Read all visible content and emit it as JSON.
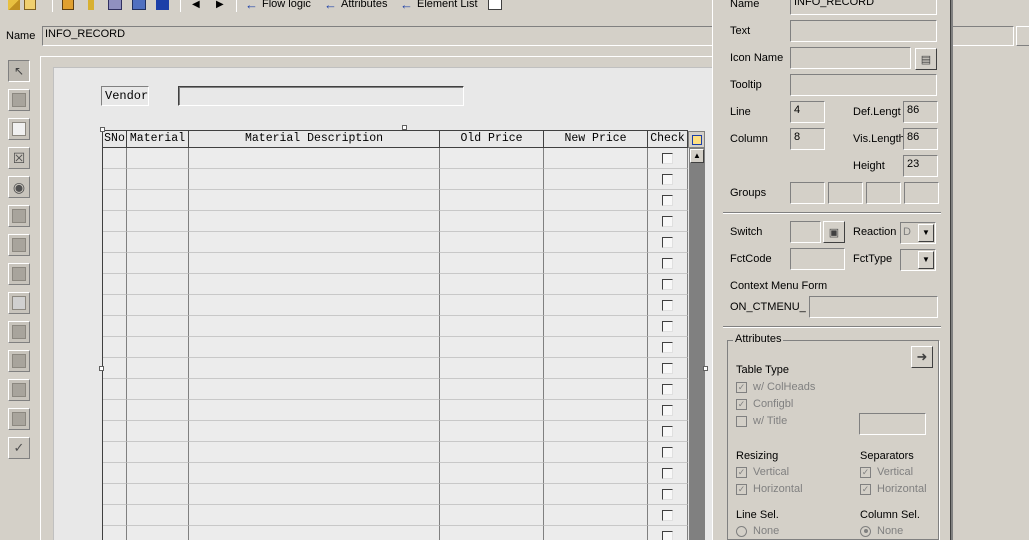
{
  "toolbar": {
    "flow_logic": "Flow logic",
    "attributes": "Attributes",
    "element_list": "Element List"
  },
  "name_row": {
    "label": "Name",
    "value": "INFO_RECORD"
  },
  "screen": {
    "vendor_label": "Vendor",
    "vendor_value": "",
    "table": {
      "headers": [
        "SNo",
        "Material",
        "Material Description",
        "Old Price",
        "New Price",
        "Check"
      ],
      "row_count": 19
    }
  },
  "panel": {
    "name_label": "Name",
    "name_value": "INFO_RECORD",
    "text_label": "Text",
    "icon_name_label": "Icon Name",
    "tooltip_label": "Tooltip",
    "line_label": "Line",
    "line_value": "4",
    "column_label": "Column",
    "column_value": "8",
    "def_length_label": "Def.Lengt",
    "def_length_value": "86",
    "vis_length_label": "Vis.Length",
    "vis_length_value": "86",
    "height_label": "Height",
    "height_value": "23",
    "groups_label": "Groups",
    "switch_label": "Switch",
    "reaction_label": "Reaction",
    "reaction_value": "D",
    "fctcode_label": "FctCode",
    "fcttype_label": "FctType",
    "context_menu_label": "Context Menu Form",
    "on_ctmenu_label": "ON_CTMENU_",
    "attributes_group": "Attributes",
    "table_type_label": "Table Type",
    "w_colheads": "w/ ColHeads",
    "configbl": "Configbl",
    "w_title": "w/ Title",
    "resizing_label": "Resizing",
    "resizing_vertical": "Vertical",
    "resizing_horizontal": "Horizontal",
    "separators_label": "Separators",
    "separators_vertical": "Vertical",
    "separators_horizontal": "Horizontal",
    "line_sel_label": "Line Sel.",
    "line_sel_none": "None",
    "column_sel_label": "Column Sel.",
    "column_sel_none": "None"
  }
}
